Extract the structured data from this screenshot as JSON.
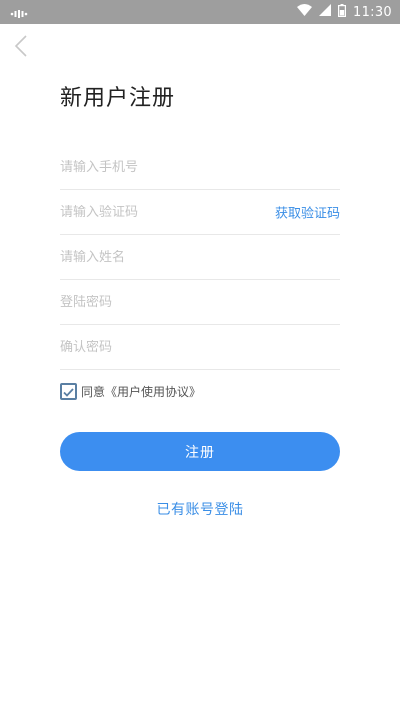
{
  "status_bar": {
    "time": "11:30",
    "icons": [
      "sim-dots-icon",
      "wifi-icon",
      "signal-icon",
      "battery-icon"
    ]
  },
  "header": {
    "back_icon": "chevron-left-icon",
    "title": "新用户注册"
  },
  "form": {
    "phone_placeholder": "请输入手机号",
    "code_placeholder": "请输入验证码",
    "get_code_label": "获取验证码",
    "name_placeholder": "请输入姓名",
    "password_placeholder": "登陆密码",
    "confirm_password_placeholder": "确认密码"
  },
  "agreement": {
    "checked": true,
    "prefix": "同意",
    "link_text": "《用户使用协议》"
  },
  "actions": {
    "register_label": "注册",
    "login_link_label": "已有账号登陆"
  },
  "colors": {
    "accent": "#3c8ef0",
    "link": "#3a8ee6",
    "status_bar": "#9e9e9e",
    "checkbox": "#5a7fa3"
  }
}
